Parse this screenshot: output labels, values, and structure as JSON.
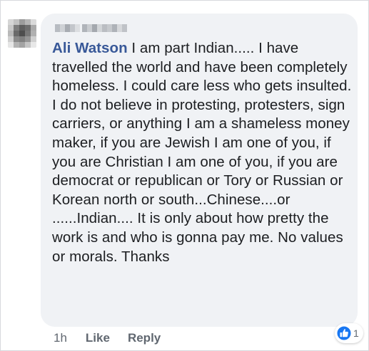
{
  "comment": {
    "author": "Ali Watson",
    "text": "I am part Indian..... I have travelled the world and have been completely homeless. I could care less who gets insulted. I do not believe in protesting, protesters, sign carriers, or anything I am a shameless money maker, if you are Jewish I am one of you, if you are Christian I am one of you, if you are democrat or republican or Tory or Russian or Korean north or south...Chinese....or ......Indian.... It is only about how pretty the work is and who is gonna pay me. No values or morals. Thanks"
  },
  "actions": {
    "timestamp": "1h",
    "like_label": "Like",
    "reply_label": "Reply"
  },
  "reactions": {
    "icon": "like-thumb-icon",
    "count": "1"
  },
  "colors": {
    "bubble_bg": "#f0f2f5",
    "author_name": "#385898",
    "text": "#1c1e21",
    "meta": "#606770",
    "like_blue": "#1877f2"
  }
}
